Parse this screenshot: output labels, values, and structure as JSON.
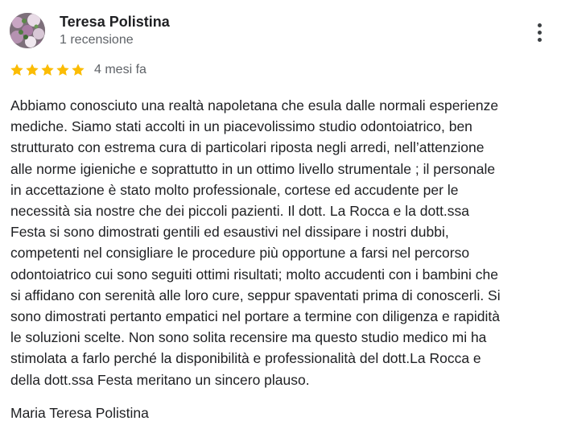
{
  "author": {
    "name": "Teresa Polistina",
    "meta": "1 recensione"
  },
  "rating": {
    "stars": 5,
    "max": 5,
    "color": "#fbbc04",
    "time_ago": "4 mesi fa"
  },
  "review": {
    "text": "Abbiamo conosciuto una realtà napoletana che esula dalle normali esperienze\nmediche. Siamo stati accolti in un piacevolissimo studio odontoiatrico, ben\nstrutturato con estrema cura di particolari riposta negli arredi, nell’attenzione\nalle norme igieniche e soprattutto in un ottimo livello strumentale ; il personale\nin accettazione è stato molto professionale, cortese ed accudente per le\nnecessità sia nostre che dei piccoli pazienti. Il dott. La Rocca e la dott.ssa\nFesta si sono dimostrati gentili ed esaustivi nel dissipare i nostri dubbi,\ncompetenti nel consigliare le procedure più opportune a farsi nel percorso\nodontoiatrico cui sono seguiti ottimi risultati; molto accudenti con i bambini che\nsi affidano con serenità alle loro cure, seppur spaventati prima di conoscerli. Si\nsono dimostrati pertanto empatici nel portare a termine con diligenza e rapidità\nle soluzioni scelte. Non sono solita recensire ma questo studio medico mi ha\nstimolata a farlo perché la disponibilità e professionalità del dott.La Rocca e\ndella dott.ssa Festa meritano un sincero plauso.",
    "signature": "Maria Teresa Polistina"
  },
  "icons": {
    "avatar": "flower-photo",
    "more": "more-vert-icon",
    "star": "star-icon"
  }
}
